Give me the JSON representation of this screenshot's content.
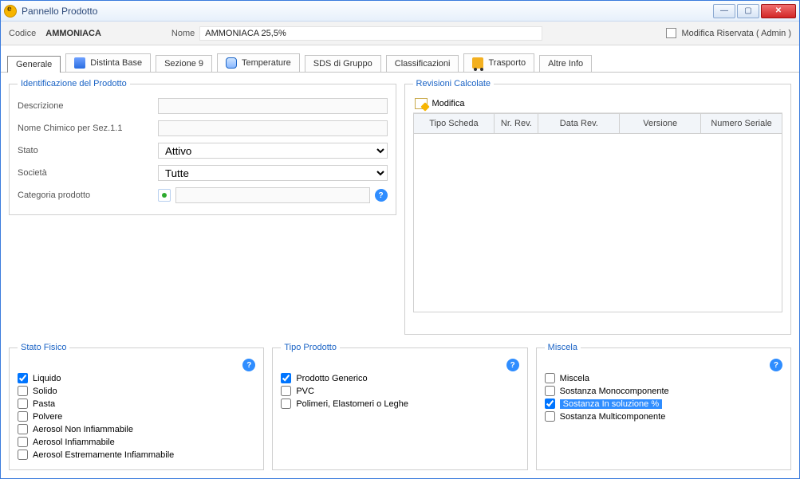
{
  "window": {
    "title": "Pannello Prodotto"
  },
  "header": {
    "codice_label": "Codice",
    "codice_value": "AMMONIACA",
    "nome_label": "Nome",
    "nome_value": "AMMONIACA 25,5%",
    "admin_label": "Modifica Riservata ( Admin )"
  },
  "tabs": {
    "generale": "Generale",
    "distinta": "Distinta Base",
    "sezione9": "Sezione 9",
    "temperature": "Temperature",
    "sds": "SDS di Gruppo",
    "classificazioni": "Classificazioni",
    "trasporto": "Trasporto",
    "altre": "Altre Info"
  },
  "ident": {
    "legend": "Identificazione del Prodotto",
    "descrizione": "Descrizione",
    "nome_chimico": "Nome Chimico per Sez.1.1",
    "stato_label": "Stato",
    "stato_value": "Attivo",
    "societa_label": "Società",
    "societa_value": "Tutte",
    "categoria_label": "Categoria prodotto"
  },
  "revisioni": {
    "legend": "Revisioni Calcolate",
    "modifica": "Modifica",
    "cols": {
      "tipo": "Tipo Scheda",
      "nrrev": "Nr. Rev.",
      "datarev": "Data Rev.",
      "versione": "Versione",
      "seriale": "Numero Seriale"
    }
  },
  "stato_fisico": {
    "legend": "Stato Fisico",
    "items": [
      "Liquido",
      "Solido",
      "Pasta",
      "Polvere",
      "Aerosol Non Infiammabile",
      "Aerosol Infiammabile",
      "Aerosol Estremamente Infiammabile"
    ]
  },
  "tipo_prodotto": {
    "legend": "Tipo Prodotto",
    "items": [
      "Prodotto Generico",
      "PVC",
      "Polimeri, Elastomeri o Leghe"
    ]
  },
  "miscela": {
    "legend": "Miscela",
    "items": [
      "Miscela",
      "Sostanza Monocomponente",
      "Sostanza In soluzione %",
      "Sostanza Multicomponente"
    ]
  }
}
